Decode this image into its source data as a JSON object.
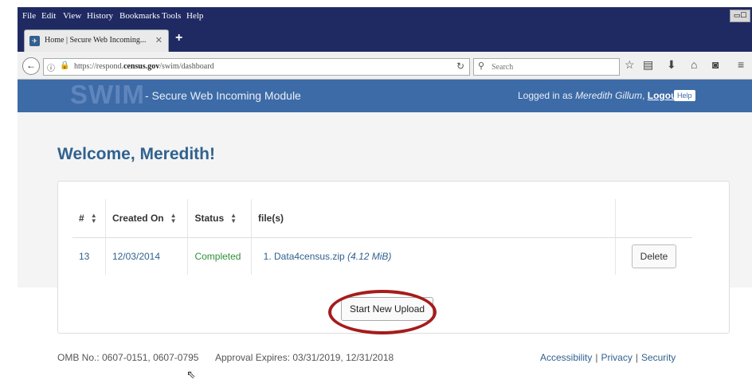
{
  "browser": {
    "menu": [
      "File",
      "Edit",
      "View",
      "History",
      "Bookmarks",
      "Tools",
      "Help"
    ],
    "tab_title": "Home | Secure Web Incoming...",
    "new_tab": "+",
    "url_scheme": "https://respond.",
    "url_domain": "census.gov",
    "url_path": "/swim/dashboard",
    "search_placeholder": "Search"
  },
  "app": {
    "logo": "SWIM",
    "title": "- Secure Web Incoming Module",
    "logged_in_prefix": "Logged in as ",
    "user": "Meredith Gillum",
    "logout": "Logout",
    "help": "Help"
  },
  "main": {
    "welcome": "Welcome, Meredith!",
    "table": {
      "headers": [
        "#",
        "Created On",
        "Status",
        "file(s)"
      ],
      "rows": [
        {
          "num": "13",
          "created": "12/03/2014",
          "status": "Completed",
          "file": "1. Data4census.zip",
          "size": "(4.12 MiB)",
          "action": "Delete"
        }
      ]
    },
    "upload_button": "Start New Upload"
  },
  "footer": {
    "omb": "OMB No.: 0607-0151, 0607-0795",
    "approval": "Approval Expires: 03/31/2019, 12/31/2018",
    "links": [
      "Accessibility",
      "Privacy",
      "Security"
    ],
    "separator": "|"
  },
  "colors": {
    "header_bar": "#3d6ba7",
    "link": "#30628f",
    "status_completed": "#2f8f3a",
    "highlight": "#a51c1c"
  }
}
